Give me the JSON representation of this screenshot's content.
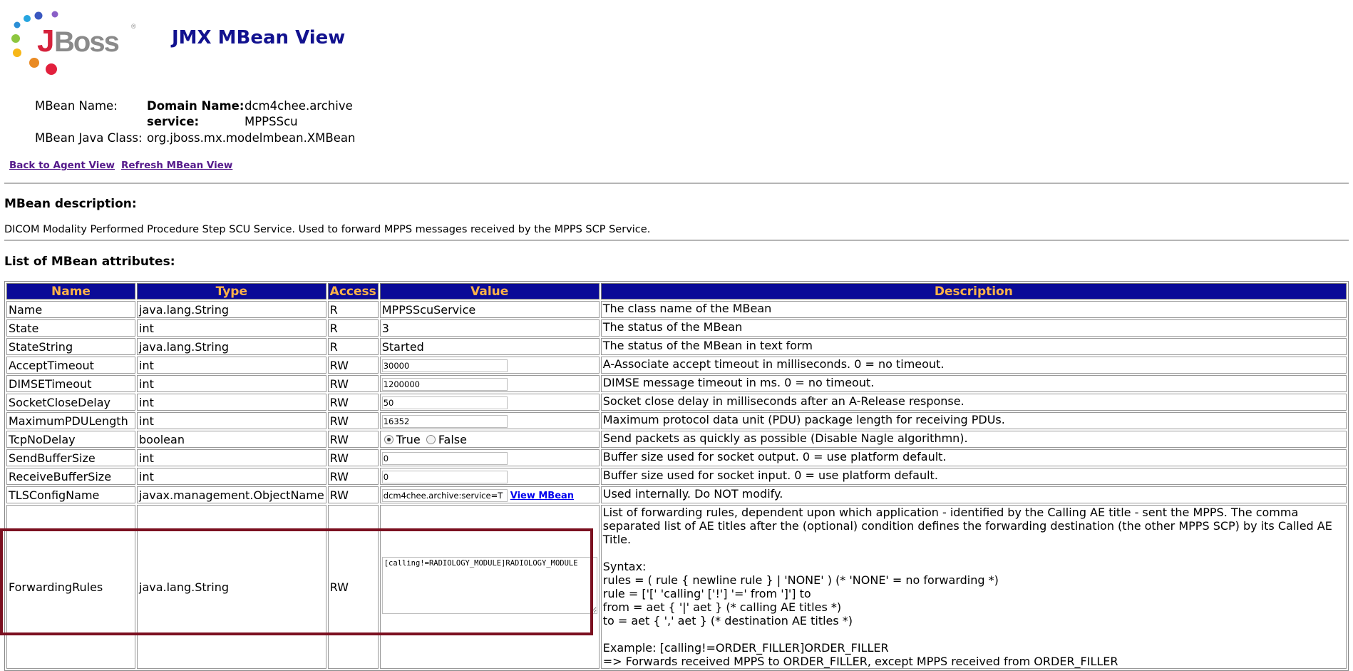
{
  "header": {
    "logo_text": "JBoss",
    "title": "JMX MBean View"
  },
  "info": {
    "mbean_name_label": "MBean Name:",
    "domain_label": "Domain Name:",
    "domain_value": "dcm4chee.archive",
    "service_label": "service:",
    "service_value": "MPPSScu",
    "java_class_label": "MBean Java Class:",
    "java_class_value": "org.jboss.mx.modelmbean.XMBean"
  },
  "links": {
    "back": "Back to Agent View",
    "refresh": "Refresh MBean View"
  },
  "description_section": {
    "title": "MBean description:",
    "text": "DICOM Modality Performed Procedure Step SCU Service. Used to forward MPPS messages received by the MPPS SCP Service."
  },
  "attributes_section": {
    "title": "List of MBean attributes:",
    "columns": [
      "Name",
      "Type",
      "Access",
      "Value",
      "Description"
    ],
    "rows": [
      {
        "name": "Name",
        "type": "java.lang.String",
        "access": "R",
        "value": "MPPSScuService",
        "description": "The class name of the MBean"
      },
      {
        "name": "State",
        "type": "int",
        "access": "R",
        "value": "3",
        "description": "The status of the MBean"
      },
      {
        "name": "StateString",
        "type": "java.lang.String",
        "access": "R",
        "value": "Started",
        "description": "The status of the MBean in text form"
      },
      {
        "name": "AcceptTimeout",
        "type": "int",
        "access": "RW",
        "value": "30000",
        "description": "A-Associate accept timeout in milliseconds. 0 = no timeout."
      },
      {
        "name": "DIMSETimeout",
        "type": "int",
        "access": "RW",
        "value": "1200000",
        "description": "DIMSE message timeout in ms. 0 = no timeout."
      },
      {
        "name": "SocketCloseDelay",
        "type": "int",
        "access": "RW",
        "value": "50",
        "description": "Socket close delay in milliseconds after an A-Release response."
      },
      {
        "name": "MaximumPDULength",
        "type": "int",
        "access": "RW",
        "value": "16352",
        "description": "Maximum protocol data unit (PDU) package length for receiving PDUs."
      },
      {
        "name": "TcpNoDelay",
        "type": "boolean",
        "access": "RW",
        "true_label": "True",
        "false_label": "False",
        "selected": "True",
        "description": "Send packets as quickly as possible (Disable Nagle algorithmn)."
      },
      {
        "name": "SendBufferSize",
        "type": "int",
        "access": "RW",
        "value": "0",
        "description": "Buffer size used for socket output. 0 = use platform default."
      },
      {
        "name": "ReceiveBufferSize",
        "type": "int",
        "access": "RW",
        "value": "0",
        "description": "Buffer size used for socket input. 0 = use platform default."
      },
      {
        "name": "TLSConfigName",
        "type": "javax.management.ObjectName",
        "access": "RW",
        "value": "dcm4chee.archive:service=T",
        "link": "View MBean",
        "description": "Used internally. Do NOT modify."
      },
      {
        "name": "ForwardingRules",
        "type": "java.lang.String",
        "access": "RW",
        "value": "[calling!=RADIOLOGY_MODULE]RADIOLOGY_MODULE",
        "description_lines": [
          "List of forwarding rules, dependent upon which application - identified by the Calling AE title - sent the MPPS. The comma separated list of AE titles after the (optional) condition defines the forwarding destination (the other MPPS SCP) by its Called AE Title.",
          "",
          "Syntax:",
          "rules = ( rule { newline rule } | 'NONE' ) (* 'NONE' = no forwarding *)",
          "rule = ['[' 'calling' ['!'] '=' from ']'] to",
          "from = aet { '|' aet } (* calling AE titles *)",
          "to = aet { ',' aet } (* destination AE titles *)",
          "",
          "Example: [calling!=ORDER_FILLER]ORDER_FILLER",
          "=> Forwards received MPPS to ORDER_FILLER, except MPPS received from ORDER_FILLER"
        ]
      }
    ]
  },
  "colors": {
    "header_bg": "#0b0b97",
    "header_text": "#ffb347",
    "title_color": "#12128f",
    "highlight": "#7b1020"
  }
}
